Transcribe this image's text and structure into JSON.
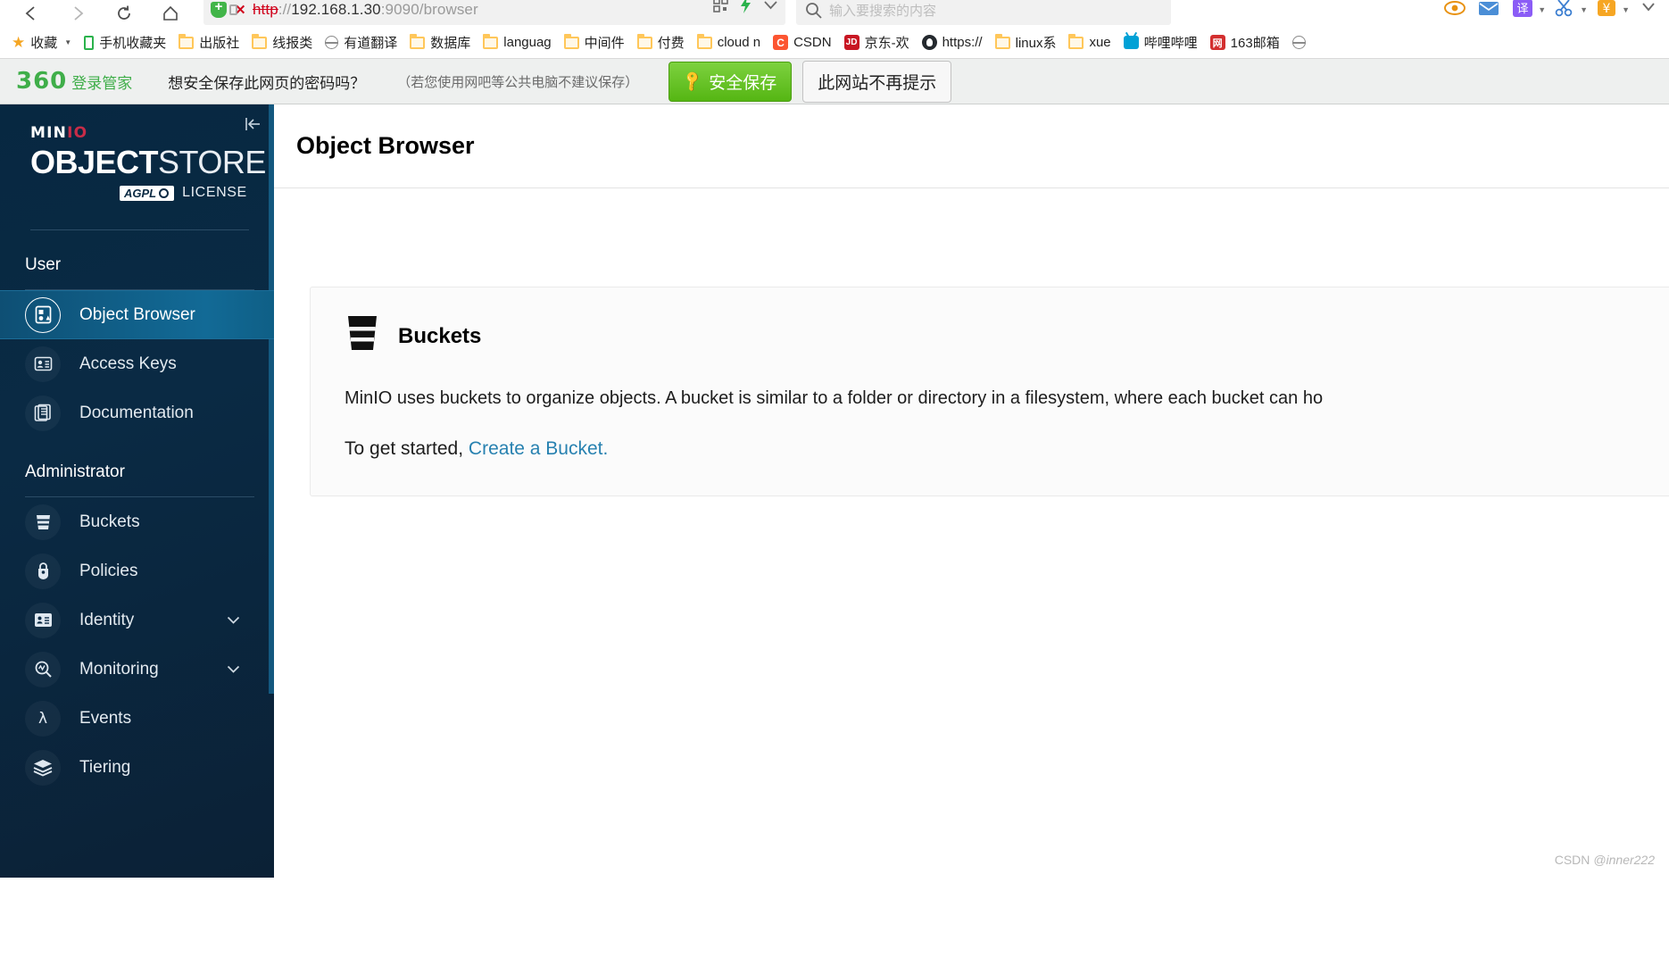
{
  "browser": {
    "nav": {
      "back": "back-arrow",
      "forward": "forward-arrow",
      "reload": "reload",
      "home": "home"
    },
    "address": {
      "scheme": "http",
      "separator": "://",
      "host": "192.168.1.30",
      "rest": ":9090/browser",
      "full_url": "http://192.168.1.30:9090/browser",
      "security_icon": "broken-lock-icon",
      "shield_icon": "360-shield-icon"
    },
    "search": {
      "placeholder": "输入要搜索的内容",
      "icon": "search-icon"
    },
    "toolbar_right": [
      {
        "name": "eye-icon",
        "glyph": "◉",
        "color": "#e8910f"
      },
      {
        "name": "mail-icon",
        "glyph": "✉",
        "color": "#4b8ed6"
      },
      {
        "name": "translate-icon",
        "glyph": "译",
        "color": "#8b5cf6"
      },
      {
        "name": "scissors-icon",
        "glyph": "✂",
        "color": "#3d7fd1"
      },
      {
        "name": "wallet-icon",
        "glyph": "¥",
        "color": "#e8910f"
      }
    ],
    "bookmarks": [
      {
        "label": "收藏",
        "icon": "star-icon",
        "has_caret": true
      },
      {
        "label": "手机收藏夹",
        "icon": "phone-icon"
      },
      {
        "label": "出版社",
        "icon": "folder-icon"
      },
      {
        "label": "线报类",
        "icon": "folder-icon"
      },
      {
        "label": "有道翻译",
        "icon": "globe-icon"
      },
      {
        "label": "数据库",
        "icon": "folder-icon"
      },
      {
        "label": "languag",
        "icon": "folder-icon"
      },
      {
        "label": "中间件",
        "icon": "folder-icon"
      },
      {
        "label": "付费",
        "icon": "folder-icon"
      },
      {
        "label": "cloud n",
        "icon": "folder-icon"
      },
      {
        "label": "CSDN",
        "icon": "csdn-icon",
        "badge": "C",
        "color": "#fc5531"
      },
      {
        "label": "京东-欢",
        "icon": "jd-icon",
        "badge": "JD",
        "color": "#c81623"
      },
      {
        "label": "https://",
        "icon": "github-icon"
      },
      {
        "label": "linux系",
        "icon": "folder-icon"
      },
      {
        "label": "xue",
        "icon": "folder-icon"
      },
      {
        "label": "哔哩哔哩",
        "icon": "bilibili-icon"
      },
      {
        "label": "163邮箱",
        "icon": "netease-icon",
        "badge": "网"
      },
      {
        "label": "",
        "icon": "globe-icon"
      }
    ]
  },
  "password_bar": {
    "brand_number": "360",
    "brand_text": "登录管家",
    "question": "想安全保存此网页的密码吗？",
    "note": "（若您使用网吧等公共电脑不建议保存）",
    "save_label": "安全保存",
    "save_icon": "key-icon",
    "never_label": "此网站不再提示"
  },
  "sidebar": {
    "logo": {
      "brand_prefix": "MIN",
      "brand_suffix": "IO",
      "product_bold": "OBJECT",
      "product_light": "STORE",
      "license_badge": "AGPL",
      "license_text": "LICENSE"
    },
    "collapse_icon": "collapse-sidebar-icon",
    "groups": [
      {
        "title": "User",
        "items": [
          {
            "label": "Object Browser",
            "icon": "object-browser-icon",
            "active": true
          },
          {
            "label": "Access Keys",
            "icon": "access-keys-icon",
            "active": false
          },
          {
            "label": "Documentation",
            "icon": "documentation-icon",
            "active": false
          }
        ]
      },
      {
        "title": "Administrator",
        "items": [
          {
            "label": "Buckets",
            "icon": "bucket-icon",
            "active": false
          },
          {
            "label": "Policies",
            "icon": "lock-icon",
            "active": false
          },
          {
            "label": "Identity",
            "icon": "identity-card-icon",
            "active": false,
            "expandable": true
          },
          {
            "label": "Monitoring",
            "icon": "monitoring-icon",
            "active": false,
            "expandable": true
          },
          {
            "label": "Events",
            "icon": "lambda-icon",
            "active": false
          },
          {
            "label": "Tiering",
            "icon": "tiering-icon",
            "active": false
          }
        ]
      }
    ]
  },
  "main": {
    "page_title": "Object Browser",
    "card": {
      "icon": "bucket-icon",
      "title": "Buckets",
      "description": "MinIO uses buckets to organize objects. A bucket is similar to a folder or directory in a filesystem, where each bucket can ho",
      "cta_prefix": "To get started, ",
      "cta_link": "Create a Bucket."
    }
  },
  "watermark": {
    "prefix": "CSDN ",
    "handle": "@inner222"
  },
  "colors": {
    "sidebar_bg": "#0a2a44",
    "sidebar_active": "#126a96",
    "minio_red": "#c72c48",
    "link_blue": "#2781b0",
    "save_green": "#55b613"
  }
}
